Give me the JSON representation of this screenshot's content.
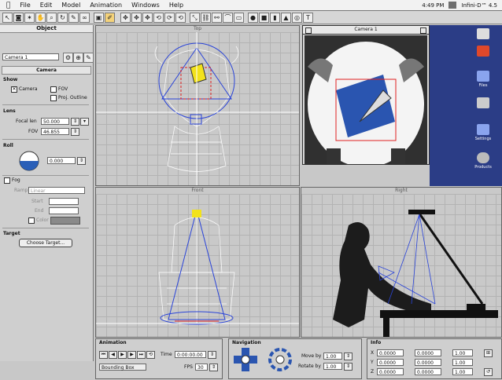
{
  "menubar": {
    "apple": "",
    "items": [
      "File",
      "Edit",
      "Model",
      "Animation",
      "Windows",
      "Help"
    ],
    "clock": "4:49 PM",
    "app_name": "Infini-D™ 4.5"
  },
  "object_panel": {
    "title": "Object",
    "object_name": "Camera 1",
    "section_title": "Camera",
    "show_group": "Show",
    "show_camera": "Camera",
    "show_fov": "FOV",
    "show_proj_outline": "Proj. Outline",
    "lens_group": "Lens",
    "focal_label": "Focal len",
    "focal_value": "50.000",
    "fov_label": "FOV",
    "fov_value": "46.855",
    "roll_group": "Roll",
    "roll_value": "0.000",
    "fog_label": "Fog",
    "ramp_label": "Ramp",
    "ramp_value": "Linear",
    "start_label": "Start",
    "end_label": "End",
    "color_label": "Color",
    "target_group": "Target",
    "choose_target": "Choose Target..."
  },
  "viewports": {
    "top": "Top",
    "camera": "Camera 1",
    "front": "Front",
    "right": "Right"
  },
  "desktop": {
    "icons": [
      {
        "name": "disk-icon",
        "label": ""
      },
      {
        "name": "app-icon",
        "label": ""
      },
      {
        "name": "folder-icon",
        "label": "Files"
      },
      {
        "name": "doc-icon",
        "label": ""
      },
      {
        "name": "folder2-icon",
        "label": "Settings"
      },
      {
        "name": "drive-icon",
        "label": "Products"
      }
    ]
  },
  "animation_panel": {
    "title": "Animation",
    "time_label": "Time",
    "time_value": "0:00:00.00",
    "mode_value": "Bounding Box",
    "fps_label": "FPS",
    "fps_value": "30"
  },
  "navigation_panel": {
    "title": "Navigation",
    "move_label": "Move by",
    "move_value": "1.00",
    "rotate_label": "Rotate by",
    "rotate_value": "1.00"
  },
  "info_panel": {
    "title": "Info",
    "x_label": "X",
    "y_label": "Y",
    "z_label": "Z",
    "x_values": [
      "0.0000",
      "0.0000"
    ],
    "y_values": [
      "0.0000",
      "0.0000"
    ],
    "z_values": [
      "0.0000",
      "0.0000"
    ],
    "extra_values": [
      "1.00",
      "1.00",
      "1.00"
    ]
  },
  "colors": {
    "wireframe": "#ffffff",
    "selection": "#2a44d8",
    "bounding": "#e02020",
    "desktop_bg": "#2b3d86",
    "target_yellow": "#f2e21a"
  }
}
